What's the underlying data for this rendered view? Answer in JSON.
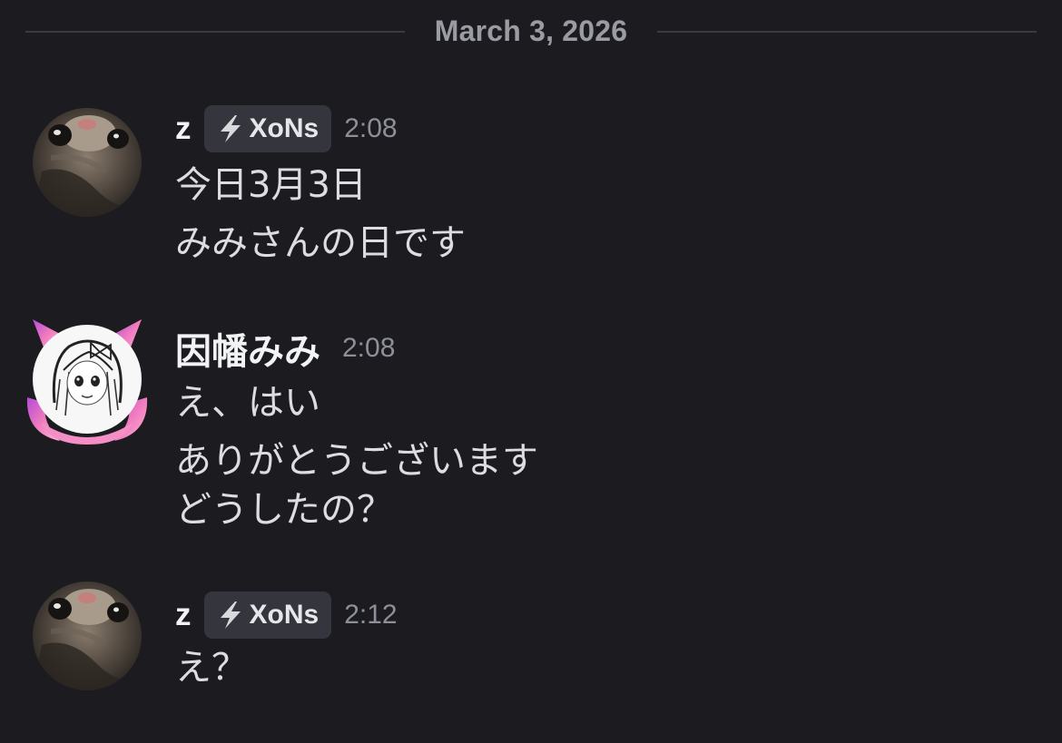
{
  "date_divider": "March 3, 2026",
  "messages": [
    {
      "username": "z",
      "tag": "XoNs",
      "time": "2:08",
      "lines": [
        "今日3月3日",
        "みみさんの日です"
      ]
    },
    {
      "username": "因幡みみ",
      "time": "2:08",
      "lines": [
        "え、はい",
        "ありがとうございます",
        "どうしたの？"
      ]
    },
    {
      "username": "z",
      "tag": "XoNs",
      "time": "2:12",
      "lines": [
        "え？"
      ]
    }
  ],
  "icons": {
    "tag_icon": "lightning-bolt-icon",
    "cat_avatar": "cat-photo-avatar",
    "anime_avatar": "anime-girl-avatar"
  },
  "colors": {
    "background": "#1b1b20",
    "tag_background": "#34353d",
    "timestamp": "#8e9099",
    "divider_text": "#9a9ba3"
  }
}
